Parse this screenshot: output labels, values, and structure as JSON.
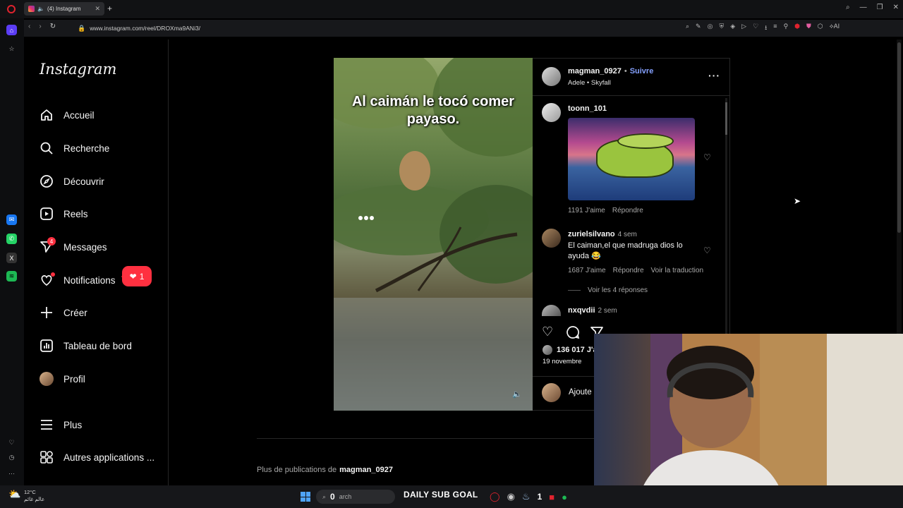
{
  "browser": {
    "tab_title": "(4) Instagram",
    "url": "www.instagram.com/reel/DROXma9ANi3/"
  },
  "nav": {
    "logo": "Instagram",
    "items": [
      {
        "label": "Accueil",
        "icon": "home-icon"
      },
      {
        "label": "Recherche",
        "icon": "search-icon"
      },
      {
        "label": "Découvrir",
        "icon": "compass-icon"
      },
      {
        "label": "Reels",
        "icon": "reels-icon"
      },
      {
        "label": "Messages",
        "icon": "messenger-icon",
        "badge": "4"
      },
      {
        "label": "Notifications",
        "icon": "heart-icon"
      },
      {
        "label": "Créer",
        "icon": "plus-icon"
      },
      {
        "label": "Tableau de bord",
        "icon": "dashboard-icon"
      },
      {
        "label": "Profil",
        "icon": "avatar"
      },
      {
        "label": "Plus",
        "icon": "menu-icon"
      },
      {
        "label": "Autres applications ...",
        "icon": "apps-icon"
      }
    ],
    "notif_count": "1"
  },
  "reel": {
    "caption": "Al caimán le tocó comer payaso."
  },
  "post": {
    "username": "magman_0927",
    "follow": "Suivre",
    "audio": "Adele • Skyfall",
    "comments": [
      {
        "user": "toonn_101",
        "likes": "1191 J'aime",
        "reply": "Répondre"
      },
      {
        "user": "zurielsilvano",
        "time": "4 sem",
        "text": "El caiman,el que madruga dios lo ayuda 😂",
        "likes": "1687 J'aime",
        "reply": "Répondre",
        "translate": "Voir la traduction",
        "replies": "Voir les 4 réponses"
      },
      {
        "user": "nxqvdii",
        "time": "2 sem"
      }
    ],
    "likes_count": "136 017 J'a",
    "date": "19 novembre",
    "add_comment": "Ajoute"
  },
  "more_posts": {
    "prefix": "Plus de publications de",
    "user": "magman_0927"
  },
  "taskbar": {
    "weather_temp": "12°C",
    "weather_text": "عالم غائم",
    "search_count": "0",
    "search_placeholder": "arch",
    "sub_goal": "DAILY SUB GOAL",
    "steam_count": "1"
  }
}
